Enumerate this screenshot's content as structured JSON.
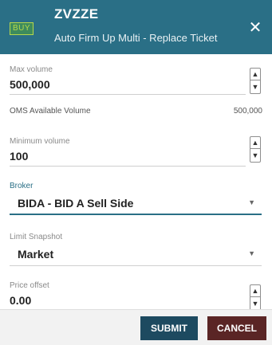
{
  "header": {
    "badge": "BUY",
    "symbol": "ZVZZE",
    "title": "Auto Firm Up Multi - Replace Ticket",
    "close_icon": "close-icon"
  },
  "fields": {
    "max_volume": {
      "label": "Max volume",
      "value": "500,000"
    },
    "oms_available": {
      "label": "OMS Available Volume",
      "value": "500,000"
    },
    "min_volume": {
      "label": "Minimum volume",
      "value": "100"
    },
    "broker": {
      "label": "Broker",
      "value": "BIDA - BID A Sell Side"
    },
    "limit_snapshot": {
      "label": "Limit Snapshot",
      "value": "Market"
    },
    "price_offset": {
      "label": "Price offset",
      "value": "0.00"
    }
  },
  "footer": {
    "submit_label": "SUBMIT",
    "cancel_label": "CANCEL"
  },
  "colors": {
    "header_bg": "#2a6f86",
    "badge_text": "#b7d84a",
    "submit_bg": "#1d4a60",
    "cancel_bg": "#5a2525"
  }
}
